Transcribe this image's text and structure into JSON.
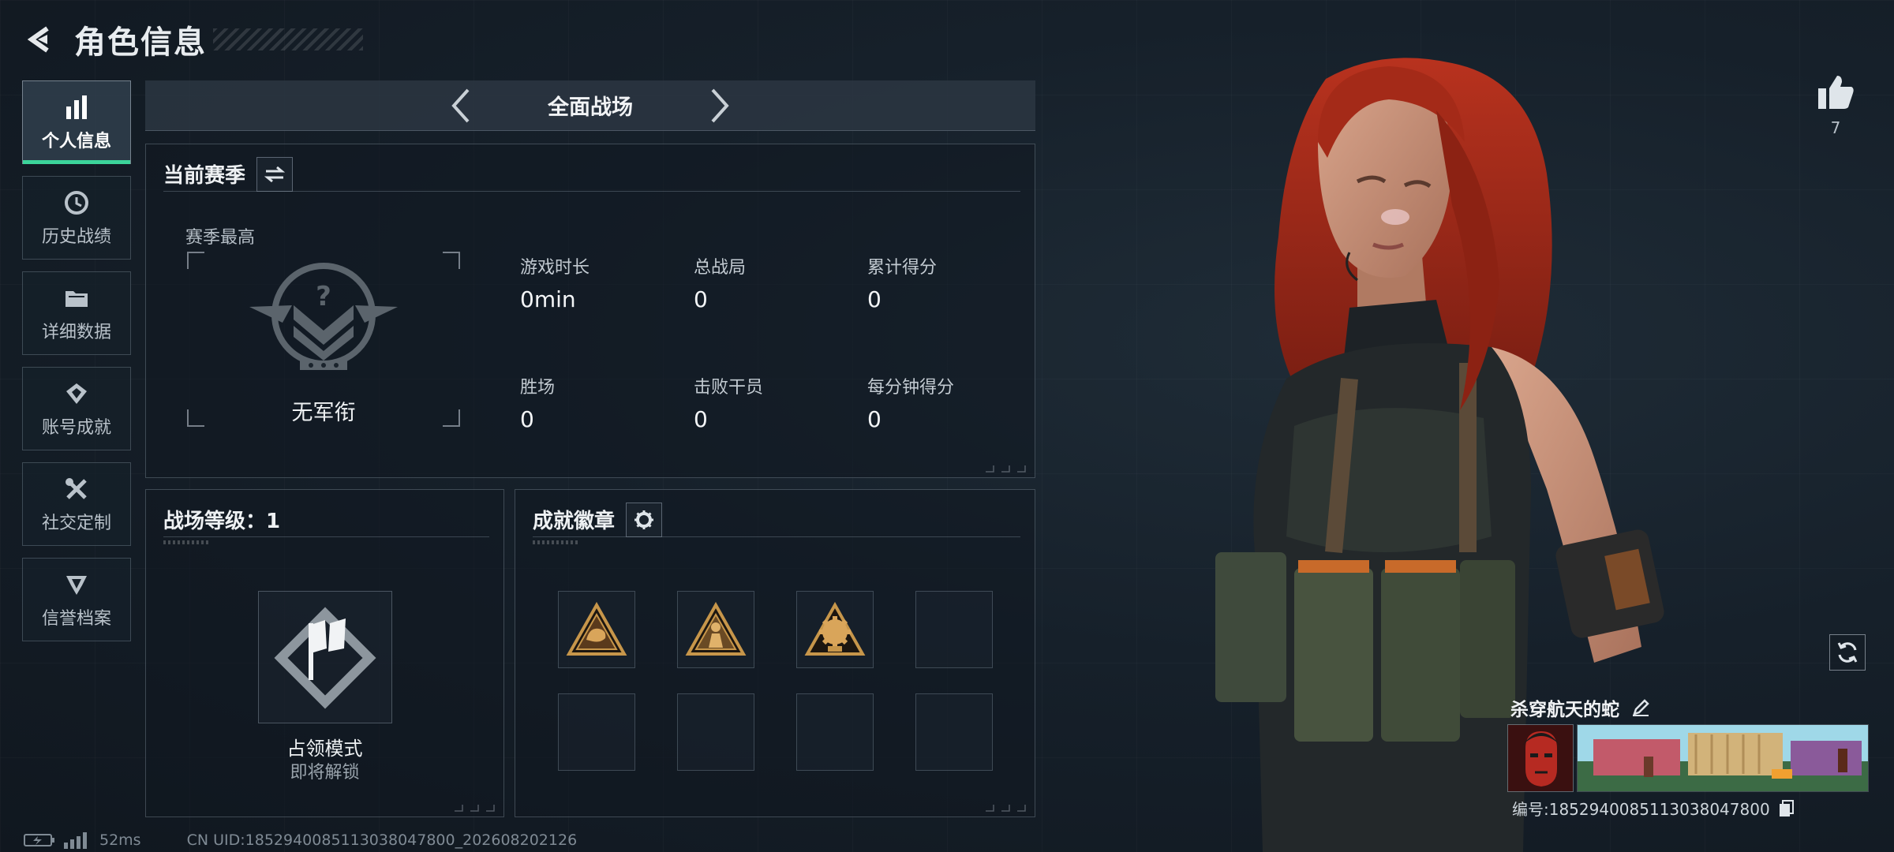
{
  "header": {
    "title": "角色信息"
  },
  "nav": {
    "items": [
      {
        "label": "个人信息",
        "icon": "bar-chart-icon",
        "active": true
      },
      {
        "label": "历史战绩",
        "icon": "history-clock-icon",
        "active": false
      },
      {
        "label": "详细数据",
        "icon": "folder-icon",
        "active": false
      },
      {
        "label": "账号成就",
        "icon": "achievement-icon",
        "active": false
      },
      {
        "label": "社交定制",
        "icon": "tools-icon",
        "active": false
      },
      {
        "label": "信誉档案",
        "icon": "credit-shield-icon",
        "active": false
      }
    ]
  },
  "mode": {
    "title": "全面战场"
  },
  "season": {
    "title": "当前赛季",
    "best_label": "赛季最高",
    "rank_name": "无军衔",
    "stats": [
      {
        "label": "游戏时长",
        "value": "0min"
      },
      {
        "label": "总战局",
        "value": "0"
      },
      {
        "label": "累计得分",
        "value": "0"
      },
      {
        "label": "胜场",
        "value": "0"
      },
      {
        "label": "击败干员",
        "value": "0"
      },
      {
        "label": "每分钟得分",
        "value": "0"
      }
    ]
  },
  "level": {
    "title": "战场等级：1",
    "mode_name": "占领模式",
    "mode_status": "即将解锁"
  },
  "badges": {
    "title": "成就徽章",
    "slots": [
      "badge-fist",
      "badge-soldier",
      "badge-gear",
      "",
      "",
      "",
      "",
      ""
    ]
  },
  "likes": {
    "count": "7"
  },
  "card": {
    "name": "杀穿航天的蛇",
    "id": "编号:1852940085113038047800"
  },
  "status": {
    "ping": "52ms",
    "uid": "CN UID:1852940085113038047800_202608202126"
  },
  "colors": {
    "accent": "#3cd49a",
    "badge_gold": "#c7964a"
  }
}
